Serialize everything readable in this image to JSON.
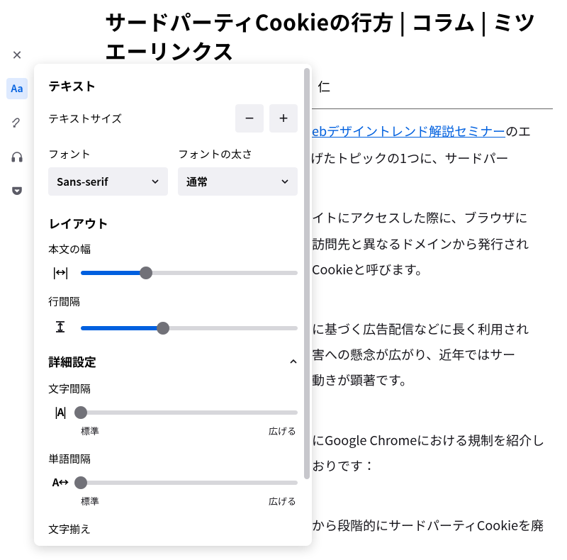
{
  "sidebar": {
    "close_label": "✕",
    "items": [
      {
        "name": "text-settings",
        "glyph": "Aa",
        "active": true
      },
      {
        "name": "theme-settings",
        "glyph": "brush",
        "active": false
      },
      {
        "name": "read-aloud",
        "glyph": "headphones",
        "active": false
      },
      {
        "name": "save-pocket",
        "glyph": "pocket",
        "active": false
      }
    ]
  },
  "article": {
    "title": "サードパーティCookieの行方 | コラム | ミツエーリンクス",
    "author_partial": "仁",
    "link_text": "ebデザイントレンド解説セミナー",
    "p1_tail": "のエ",
    "p2": "げたトピックの1つに、サードパー",
    "p3a": "イトにアクセスした際に、ブラウザに",
    "p3b": "訪問先と異なるドメインから発行され",
    "p3c": "Cookieと呼びます。",
    "p4a": "に基づく広告配信などに長く利用され",
    "p4b": "害への懸念が広がり、近年ではサー",
    "p4c": "動きが顕著です。",
    "p5a": "にGoogle Chromeにおける規制を紹介し",
    "p5b": "おりです：",
    "p6": "から段階的にサードパーティCookieを廃"
  },
  "panel": {
    "text_section": "テキスト",
    "text_size_label": "テキストサイズ",
    "minus": "−",
    "plus": "+",
    "font_label": "フォント",
    "font_value": "Sans-serif",
    "weight_label": "フォントの太さ",
    "weight_value": "通常",
    "layout_section": "レイアウト",
    "width_label": "本文の幅",
    "width_icon": "|↔|",
    "width_pct": 30,
    "line_label": "行間隔",
    "line_icon": "⇳",
    "line_pct": 38,
    "adv_section": "詳細設定",
    "char_label": "文字間隔",
    "char_icon": "|A|",
    "char_pct": 0,
    "word_label": "単語間隔",
    "word_icon": "A↔",
    "word_pct": 0,
    "tick_standard": "標準",
    "tick_wide": "広げる",
    "align_label": "文字揃え"
  }
}
